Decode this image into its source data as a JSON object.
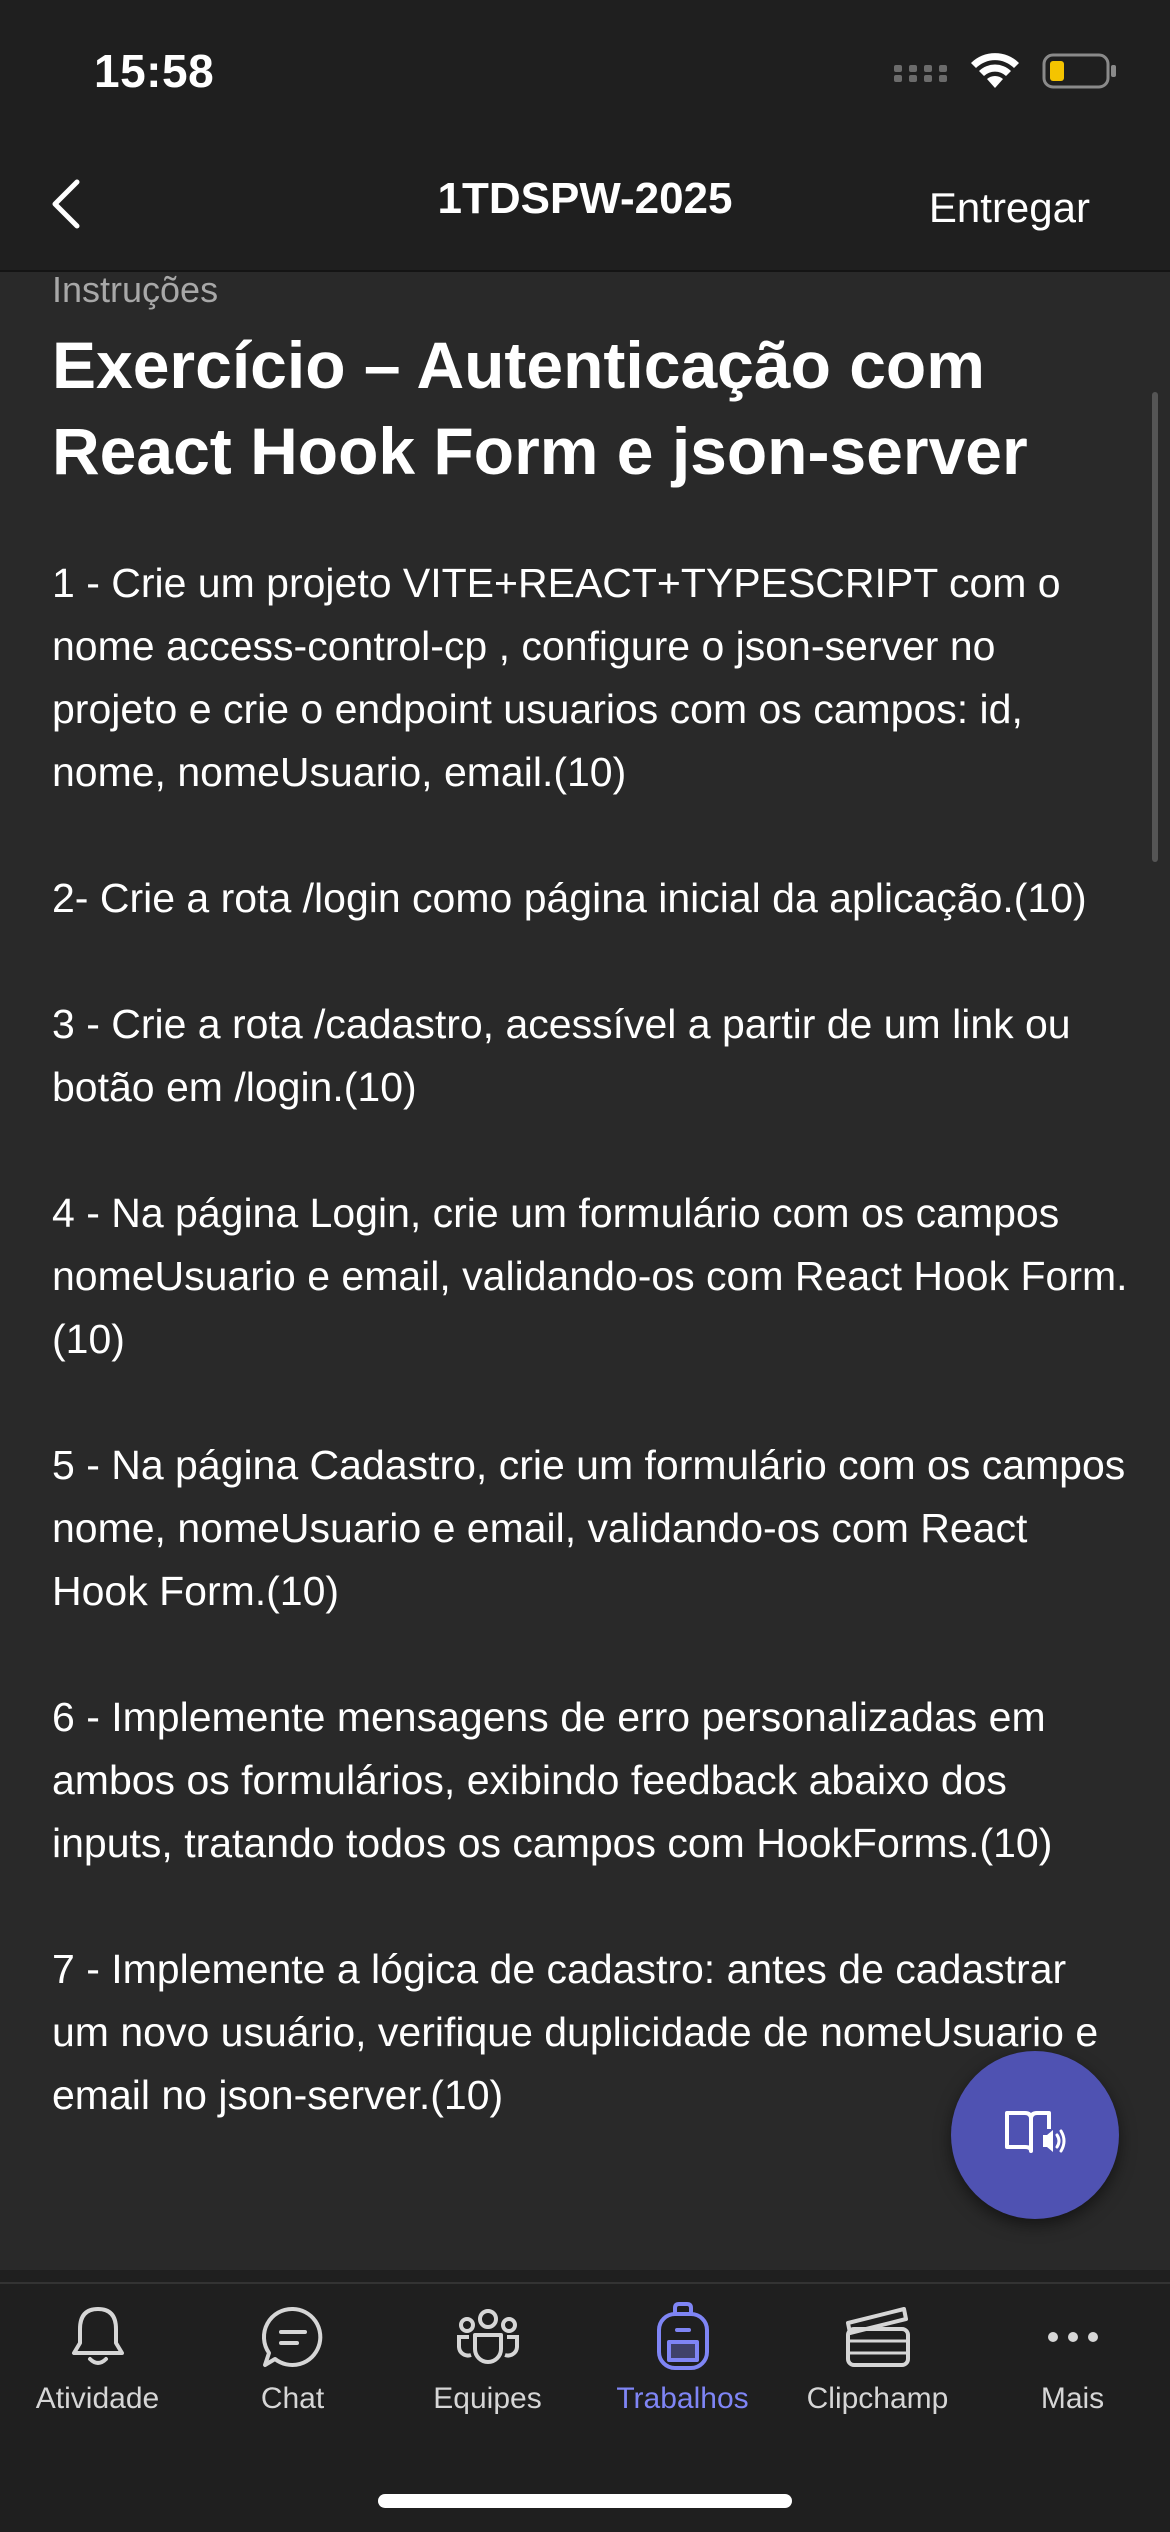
{
  "status_bar": {
    "time": "15:58",
    "icons": [
      "cellular-signal-icon",
      "wifi-icon",
      "battery-low-icon"
    ],
    "battery_color": "#f5c400"
  },
  "header": {
    "title": "1TDSPW-2025",
    "back_icon": "chevron-left-icon",
    "action_label": "Entregar"
  },
  "content": {
    "section_label": "Instruções",
    "title": "Exercício – Autenticação com React Hook Form e json-server",
    "paragraphs": [
      "1 - Crie um projeto VITE+REACT+TYPESCRIPT com o nome access-control-cp , configure o json-server no projeto e crie o endpoint usuarios com os campos: id, nome, nomeUsuario, email.(10)",
      "2- Crie a rota /login como página inicial da aplicação.(10)",
      "3 - Crie a rota /cadastro, acessível a partir de um link ou botão em /login.(10)",
      "4 - Na página Login, crie um formulário com os campos nomeUsuario e email, validando-os com React Hook Form.(10)",
      "5 - Na página Cadastro, crie um formulário com os campos nome, nomeUsuario e email, validando-os com React Hook Form.(10)",
      "6 - Implemente mensagens de erro personalizadas em ambos os formulários, exibindo feedback abaixo dos inputs, tratando todos os campos com HookForms.(10)",
      "7 - Implemente a lógica de cadastro: antes de cadastrar um novo usuário, verifique duplicidade de nomeUsuario e email no json-server.(10)"
    ],
    "fab_icon": "immersive-reader-icon"
  },
  "tab_bar": {
    "accent_color": "#7f85f5",
    "tabs": [
      {
        "label": "Atividade",
        "icon": "bell-icon",
        "active": false
      },
      {
        "label": "Chat",
        "icon": "chat-bubble-icon",
        "active": false
      },
      {
        "label": "Equipes",
        "icon": "teams-people-icon",
        "active": false
      },
      {
        "label": "Trabalhos",
        "icon": "backpack-icon",
        "active": true
      },
      {
        "label": "Clipchamp",
        "icon": "clapperboard-icon",
        "active": false
      },
      {
        "label": "Mais",
        "icon": "more-dots-icon",
        "active": false
      }
    ]
  }
}
